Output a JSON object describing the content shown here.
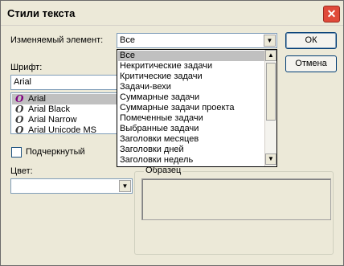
{
  "window": {
    "title": "Стили текста",
    "close_glyph": "✕"
  },
  "element_field": {
    "label": "Изменяемый элемент:",
    "value": "Все",
    "options": [
      "Все",
      "Некритические задачи",
      "Критические задачи",
      "Задачи-вехи",
      "Суммарные задачи",
      "Суммарные задачи проекта",
      "Помеченные задачи",
      "Выбранные задачи",
      "Заголовки месяцев",
      "Заголовки дней",
      "Заголовки недель"
    ],
    "selected_index": 0
  },
  "buttons": {
    "ok": "ОК",
    "cancel": "Отмена"
  },
  "font": {
    "label": "Шрифт:",
    "value": "Arial",
    "list": [
      "Arial",
      "Arial Black",
      "Arial Narrow",
      "Arial Unicode MS"
    ],
    "selected_index": 0,
    "glyph": "O"
  },
  "underline": {
    "label": "Подчеркнутый",
    "checked": false
  },
  "color": {
    "label": "Цвет:",
    "value": ""
  },
  "sample": {
    "label": "Образец"
  },
  "icons": {
    "combo_arrow": "chevron-down-icon",
    "scroll_up": "chevron-up-icon",
    "scroll_down": "chevron-down-icon"
  },
  "colors": {
    "accent": "#e04a3a",
    "dialog_bg": "#ece9d8",
    "selection": "#c0c0c0"
  }
}
